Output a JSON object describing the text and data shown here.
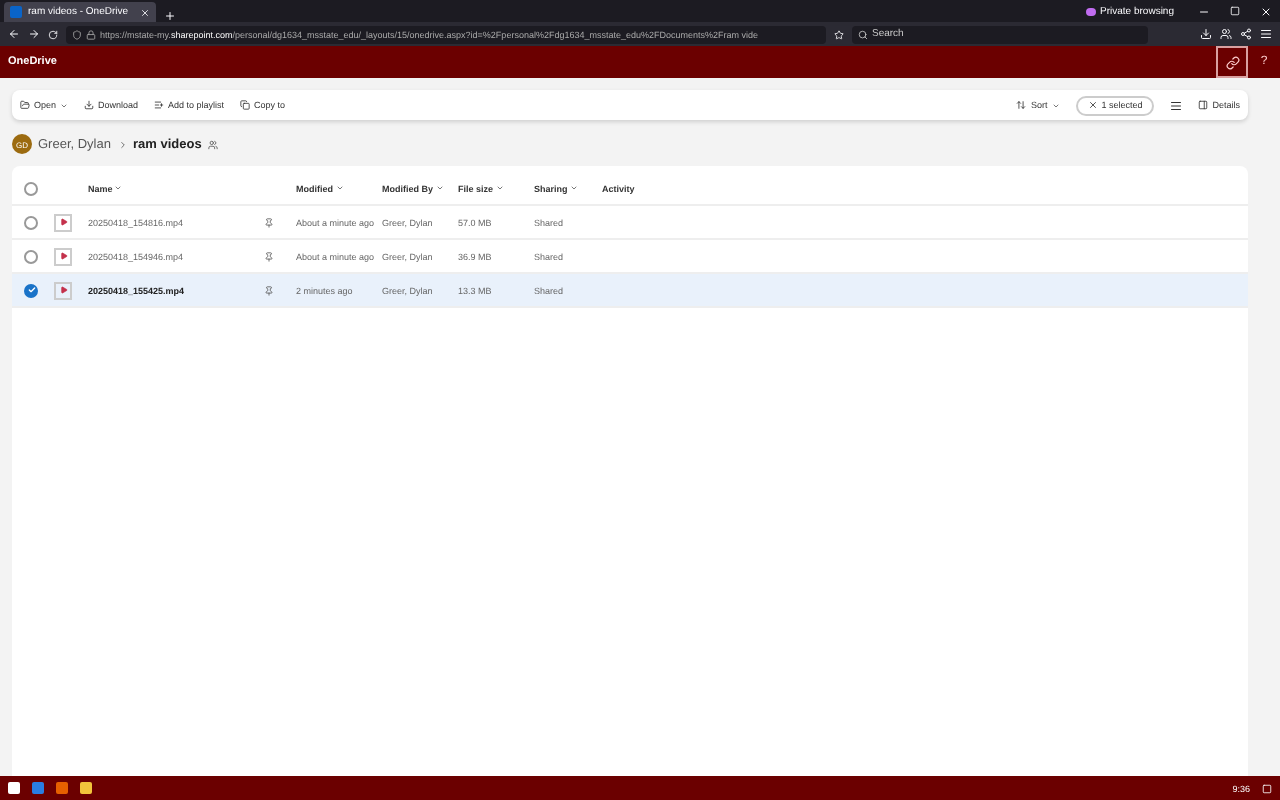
{
  "browser": {
    "tab_title": "ram videos - OneDrive",
    "url": "https://mstate-my.**sharepoint.com**/personal/dg1634_msstate_edu/_layouts/15/onedrive.aspx?id=%2Fpersonal%2Fdg1634_msstate_edu%2FDocuments%2Fram vide",
    "search_placeholder": "Search",
    "private_label": "Private browsing"
  },
  "app": {
    "title": "OneDrive",
    "help": "?"
  },
  "toolbar": {
    "left": [
      {
        "label": "Open",
        "kind": "open"
      },
      {
        "label": "Download",
        "kind": "download"
      },
      {
        "label": "Add to playlist",
        "kind": "playlist"
      },
      {
        "label": "Copy to",
        "kind": "copy"
      }
    ],
    "sort": "Sort",
    "selection": "1 selected",
    "details": "Details"
  },
  "breadcrumb": {
    "initials": "GD",
    "owner": "Greer, Dylan",
    "folder": "ram videos"
  },
  "table": {
    "select_all": false,
    "columns": [
      "Name",
      "Modified",
      "Modified By",
      "File size",
      "Sharing",
      "Activity"
    ],
    "rows": [
      {
        "name": "20250418_154816.mp4",
        "modified": "About a minute ago",
        "modified_by": "Greer, Dylan",
        "size": "57.0 MB",
        "sharing": "Shared",
        "selected": false
      },
      {
        "name": "20250418_154946.mp4",
        "modified": "About a minute ago",
        "modified_by": "Greer, Dylan",
        "size": "36.9 MB",
        "sharing": "Shared",
        "selected": false
      },
      {
        "name": "20250418_155425.mp4",
        "modified": "2 minutes ago",
        "modified_by": "Greer, Dylan",
        "size": "13.3 MB",
        "sharing": "Shared",
        "selected": true
      }
    ]
  },
  "taskbar": {
    "time": "9:36"
  }
}
